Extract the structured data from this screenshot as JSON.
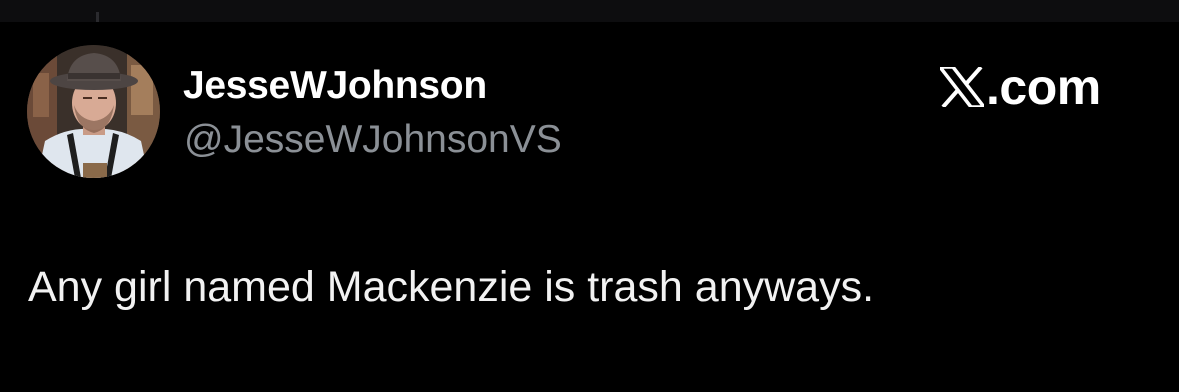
{
  "tweet": {
    "author": {
      "display_name": "JesseWJohnson",
      "handle": "@JesseWJohnsonVS",
      "avatar_icon": "profile-photo-man-in-hat"
    },
    "brand": {
      "logo_icon": "x-logo-icon",
      "domain_suffix": ".com"
    },
    "text": "Any girl named Mackenzie is trash anyways."
  },
  "colors": {
    "background": "#000000",
    "text_primary": "#ffffff",
    "text_secondary": "#8b9096"
  }
}
